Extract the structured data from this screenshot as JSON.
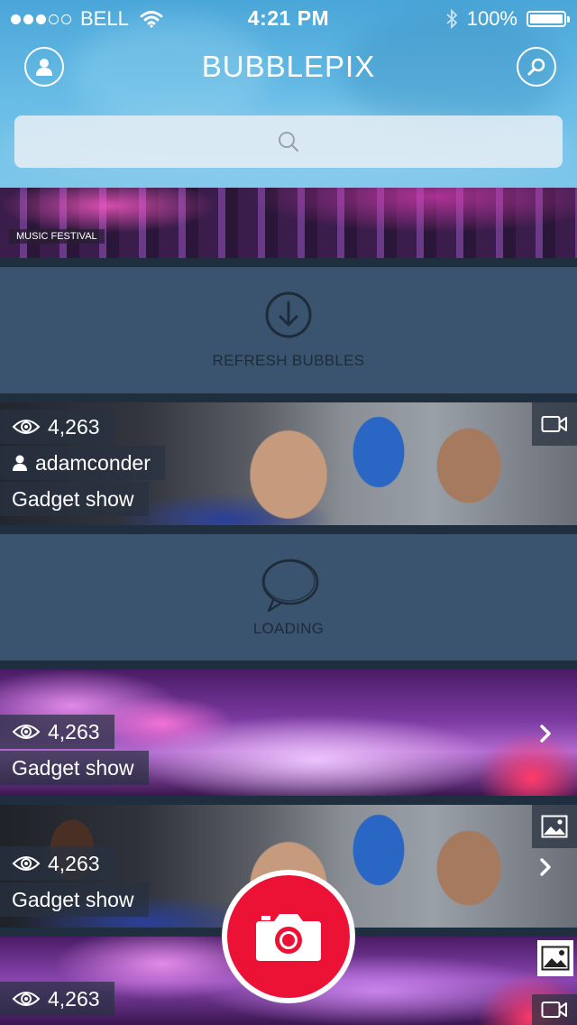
{
  "status_bar": {
    "carrier": "BELL",
    "time": "4:21 PM",
    "battery": "100%",
    "signal_bars_filled": 3,
    "signal_bars_total": 5
  },
  "header": {
    "title": "BUBBLEPIX",
    "profile_icon": "user-circle-icon",
    "search_icon": "search-circle-icon"
  },
  "search": {
    "placeholder": ""
  },
  "feed": {
    "top_item": {
      "tag": "MUSIC FESTIVAL"
    },
    "refresh_panel": {
      "label": "REFRESH BUBBLES",
      "icon": "download-arrow-circle-icon"
    },
    "item_1": {
      "views": "4,263",
      "user": "adamconder",
      "title": "Gadget show",
      "media_icon": "video-camera-icon"
    },
    "loading_panel": {
      "label": "LOADING",
      "icon": "speech-bubble-scribble-icon"
    },
    "item_2": {
      "views": "4,263",
      "title": "Gadget show",
      "action_icon": "chevron-right-icon"
    },
    "item_3": {
      "views": "4,263",
      "title": "Gadget show",
      "media_icon": "image-icon",
      "action_icon": "chevron-right-icon"
    },
    "item_4": {
      "views": "4,263",
      "media_icon_1": "image-icon",
      "media_icon_2": "video-camera-icon"
    }
  },
  "camera_button": {
    "icon": "camera-icon"
  },
  "colors": {
    "header_blue": "#5cb4e2",
    "panel_blue": "#3a5470",
    "camera_red": "#ec1236",
    "label_bg": "rgba(40,50,65,.72)"
  }
}
